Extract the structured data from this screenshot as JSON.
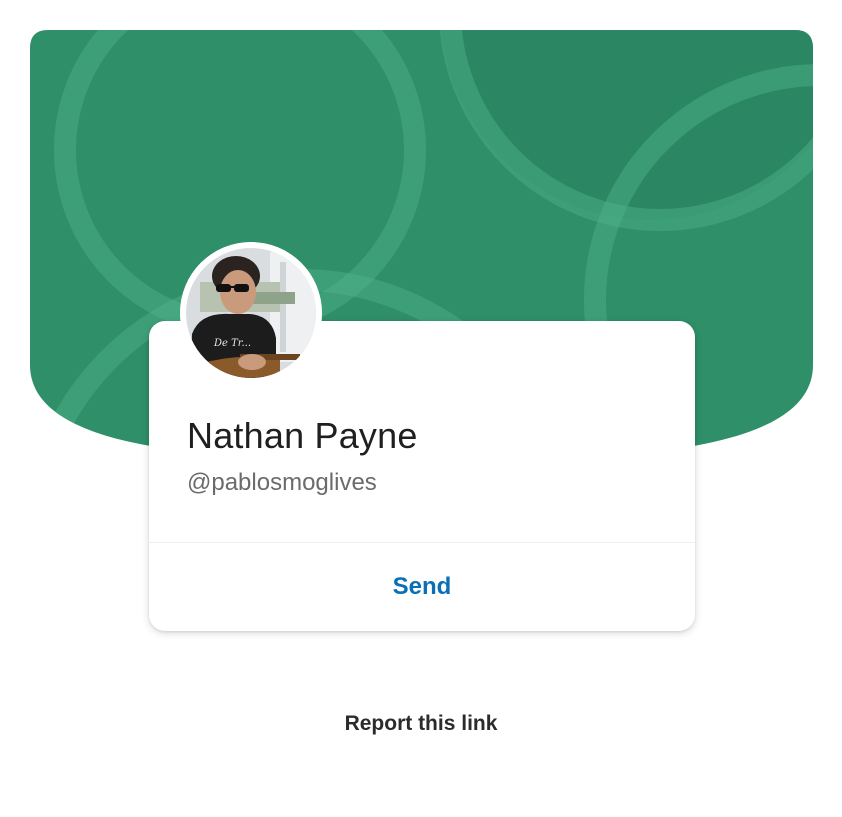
{
  "profile": {
    "name": "Nathan Payne",
    "handle": "@pablosmoglives",
    "avatar_icon": "profile-photo"
  },
  "actions": {
    "send_label": "Send"
  },
  "footer": {
    "report_label": "Report this link"
  },
  "colors": {
    "banner": "#2f8f69",
    "banner_rings": "#4fb38c",
    "send": "#0b6fb5",
    "name": "#1f1f1f",
    "handle": "#6b6b6b"
  }
}
